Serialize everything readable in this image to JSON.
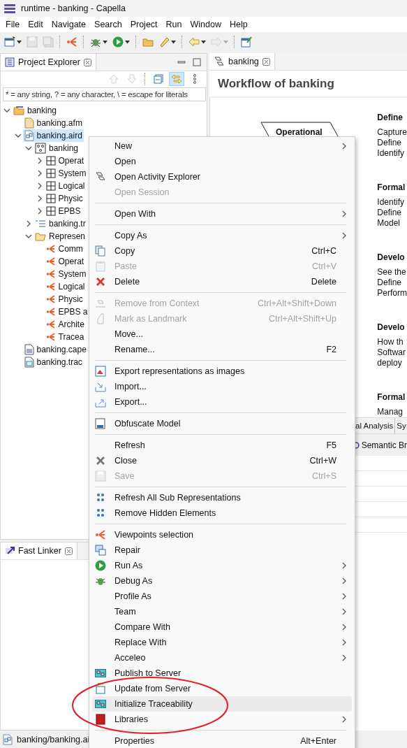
{
  "window": {
    "title": "runtime - banking - Capella"
  },
  "menu_bar": [
    "File",
    "Edit",
    "Navigate",
    "Search",
    "Project",
    "Run",
    "Window",
    "Help"
  ],
  "toolbar": [
    {
      "kind": "new",
      "disabled": false,
      "dropdown": true
    },
    {
      "kind": "save",
      "disabled": true,
      "dropdown": false
    },
    {
      "kind": "save-all",
      "disabled": true,
      "dropdown": false
    },
    {
      "kind": "separator"
    },
    {
      "kind": "capella",
      "disabled": false,
      "dropdown": false
    },
    {
      "kind": "separator"
    },
    {
      "kind": "debug",
      "disabled": false,
      "dropdown": true
    },
    {
      "kind": "run",
      "disabled": false,
      "dropdown": true
    },
    {
      "kind": "separator"
    },
    {
      "kind": "open",
      "disabled": false,
      "dropdown": false
    },
    {
      "kind": "pen",
      "disabled": false,
      "dropdown": true
    },
    {
      "kind": "separator"
    },
    {
      "kind": "back",
      "disabled": false,
      "dropdown": true
    },
    {
      "kind": "forward",
      "disabled": true,
      "dropdown": true
    },
    {
      "kind": "separator"
    },
    {
      "kind": "note",
      "disabled": false,
      "dropdown": false
    }
  ],
  "explorer": {
    "tab": {
      "label": "Project Explorer",
      "selected": true
    },
    "view_toolbar": [
      {
        "kind": "up",
        "disabled": true,
        "on": false
      },
      {
        "kind": "down",
        "disabled": true,
        "on": false
      },
      {
        "kind": "separator"
      },
      {
        "kind": "collapse",
        "disabled": false,
        "on": false
      },
      {
        "kind": "link",
        "disabled": false,
        "on": true
      },
      {
        "kind": "more",
        "disabled": false,
        "on": false
      }
    ],
    "filter": {
      "placeholder": "* = any string, ? = any character, \\ = escape for literals"
    },
    "tree": [
      {
        "label": "banking",
        "kind": "project",
        "expanded": true,
        "selected": false,
        "children": [
          {
            "label": "banking.afm",
            "kind": "afm",
            "selected": false
          },
          {
            "label": "banking.aird",
            "kind": "aird",
            "expanded": true,
            "selected": true,
            "children": [
              {
                "label": "banking",
                "kind": "model",
                "expanded": true,
                "selected": false,
                "children": [
                  {
                    "label": "Operat",
                    "kind": "layer",
                    "expanded": false,
                    "selected": false
                  },
                  {
                    "label": "System",
                    "kind": "layer",
                    "expanded": false,
                    "selected": false
                  },
                  {
                    "label": "Logical",
                    "kind": "layer",
                    "expanded": false,
                    "selected": false
                  },
                  {
                    "label": "Physic",
                    "kind": "layer",
                    "expanded": false,
                    "selected": false
                  },
                  {
                    "label": "EPBS",
                    "kind": "layer",
                    "expanded": false,
                    "selected": false
                  }
                ]
              },
              {
                "label": "banking.tr",
                "kind": "list",
                "expanded": false,
                "selected": false
              },
              {
                "label": "Represen",
                "kind": "folder",
                "expanded": true,
                "selected": false,
                "children": [
                  {
                    "label": "Comm",
                    "kind": "viewpoint",
                    "selected": false
                  },
                  {
                    "label": "Operat",
                    "kind": "viewpoint",
                    "selected": false
                  },
                  {
                    "label": "System",
                    "kind": "viewpoint",
                    "selected": false
                  },
                  {
                    "label": "Logical",
                    "kind": "viewpoint",
                    "selected": false
                  },
                  {
                    "label": "Physic",
                    "kind": "viewpoint",
                    "selected": false
                  },
                  {
                    "label": "EPBS a",
                    "kind": "viewpoint",
                    "selected": false
                  },
                  {
                    "label": "Archite",
                    "kind": "viewpoint",
                    "selected": false
                  },
                  {
                    "label": "Tracea",
                    "kind": "viewpoint",
                    "selected": false
                  }
                ]
              }
            ]
          },
          {
            "label": "banking.cape",
            "kind": "capella",
            "selected": false
          },
          {
            "label": "banking.trac",
            "kind": "trace",
            "selected": false
          }
        ]
      }
    ]
  },
  "fast_linker": {
    "tab": {
      "label": "Fast Linker",
      "selected": true
    }
  },
  "editor": {
    "tab": {
      "label": "banking",
      "selected": true
    },
    "heading": "Workflow of banking",
    "diagram_node": "Operational",
    "sections": [
      {
        "title": "Define",
        "lines": [
          "Capture",
          "Define",
          "Identify"
        ]
      },
      {
        "title": "Formal",
        "lines": [
          "Identify",
          "Define",
          "Model"
        ]
      },
      {
        "title": "Develo",
        "lines": [
          "See the",
          "Define",
          "Perform"
        ]
      },
      {
        "title": "Develo",
        "lines": [
          "How th",
          "Softwar",
          "deploy"
        ]
      },
      {
        "title": "Formal",
        "lines": [
          "Manag"
        ]
      }
    ]
  },
  "bottom_panel": {
    "tabs": [
      {
        "label": "al Analysis",
        "selected": false
      },
      {
        "label": "Sy",
        "selected": false
      }
    ],
    "view_tab": {
      "label": "Semantic Br"
    }
  },
  "status_bar": {
    "text": "banking/banking.ai"
  },
  "context_menu": [
    {
      "kind": "item",
      "label": "New",
      "submenu": true,
      "disabled": false,
      "selected": false
    },
    {
      "kind": "item",
      "label": "Open",
      "submenu": false,
      "disabled": false,
      "selected": false
    },
    {
      "kind": "item",
      "label": "Open Activity Explorer",
      "submenu": false,
      "disabled": false,
      "selected": false
    },
    {
      "kind": "item",
      "label": "Open Session",
      "submenu": false,
      "disabled": true,
      "selected": false
    },
    {
      "kind": "separator"
    },
    {
      "kind": "item",
      "label": "Open With",
      "submenu": true,
      "disabled": false,
      "selected": false
    },
    {
      "kind": "separator"
    },
    {
      "kind": "item",
      "label": "Copy As",
      "submenu": true,
      "disabled": false,
      "selected": false
    },
    {
      "kind": "item",
      "label": "Copy",
      "shortcut": "Ctrl+C",
      "submenu": false,
      "disabled": false,
      "selected": false
    },
    {
      "kind": "item",
      "label": "Paste",
      "shortcut": "Ctrl+V",
      "submenu": false,
      "disabled": true,
      "selected": false
    },
    {
      "kind": "item",
      "label": "Delete",
      "shortcut": "Delete",
      "submenu": false,
      "disabled": false,
      "selected": false
    },
    {
      "kind": "separator"
    },
    {
      "kind": "item",
      "label": "Remove from Context",
      "shortcut": "Ctrl+Alt+Shift+Down",
      "submenu": false,
      "disabled": true,
      "selected": false
    },
    {
      "kind": "item",
      "label": "Mark as Landmark",
      "shortcut": "Ctrl+Alt+Shift+Up",
      "submenu": false,
      "disabled": true,
      "selected": false
    },
    {
      "kind": "item",
      "label": "Move...",
      "submenu": false,
      "disabled": false,
      "selected": false
    },
    {
      "kind": "item",
      "label": "Rename...",
      "shortcut": "F2",
      "submenu": false,
      "disabled": false,
      "selected": false
    },
    {
      "kind": "separator"
    },
    {
      "kind": "item",
      "label": "Export representations as images",
      "submenu": false,
      "disabled": false,
      "selected": false
    },
    {
      "kind": "item",
      "label": "Import...",
      "submenu": false,
      "disabled": false,
      "selected": false
    },
    {
      "kind": "item",
      "label": "Export...",
      "submenu": false,
      "disabled": false,
      "selected": false
    },
    {
      "kind": "separator"
    },
    {
      "kind": "item",
      "label": "Obfuscate Model",
      "submenu": false,
      "disabled": false,
      "selected": false
    },
    {
      "kind": "separator"
    },
    {
      "kind": "item",
      "label": "Refresh",
      "shortcut": "F5",
      "submenu": false,
      "disabled": false,
      "selected": false
    },
    {
      "kind": "item",
      "label": "Close",
      "shortcut": "Ctrl+W",
      "submenu": false,
      "disabled": false,
      "selected": false
    },
    {
      "kind": "item",
      "label": "Save",
      "shortcut": "Ctrl+S",
      "submenu": false,
      "disabled": true,
      "selected": false
    },
    {
      "kind": "separator"
    },
    {
      "kind": "item",
      "label": "Refresh All Sub Representations",
      "submenu": false,
      "disabled": false,
      "selected": false
    },
    {
      "kind": "item",
      "label": "Remove Hidden Elements",
      "submenu": false,
      "disabled": false,
      "selected": false
    },
    {
      "kind": "separator"
    },
    {
      "kind": "item",
      "label": "Viewpoints selection",
      "submenu": false,
      "disabled": false,
      "selected": false
    },
    {
      "kind": "item",
      "label": "Repair",
      "submenu": false,
      "disabled": false,
      "selected": false
    },
    {
      "kind": "item",
      "label": "Run As",
      "submenu": true,
      "disabled": false,
      "selected": false
    },
    {
      "kind": "item",
      "label": "Debug As",
      "submenu": true,
      "disabled": false,
      "selected": false
    },
    {
      "kind": "item",
      "label": "Profile As",
      "submenu": true,
      "disabled": false,
      "selected": false
    },
    {
      "kind": "item",
      "label": "Team",
      "submenu": true,
      "disabled": false,
      "selected": false
    },
    {
      "kind": "item",
      "label": "Compare With",
      "submenu": true,
      "disabled": false,
      "selected": false
    },
    {
      "kind": "item",
      "label": "Replace With",
      "submenu": true,
      "disabled": false,
      "selected": false
    },
    {
      "kind": "item",
      "label": "Acceleo",
      "submenu": true,
      "disabled": false,
      "selected": false
    },
    {
      "kind": "item",
      "label": "Publish to Server",
      "submenu": false,
      "disabled": false,
      "selected": false
    },
    {
      "kind": "item",
      "label": "Update from Server",
      "submenu": false,
      "disabled": false,
      "selected": false
    },
    {
      "kind": "item",
      "label": "Initialize Traceability",
      "submenu": false,
      "disabled": false,
      "selected": true
    },
    {
      "kind": "item",
      "label": "Libraries",
      "submenu": true,
      "disabled": false,
      "selected": false
    },
    {
      "kind": "separator"
    },
    {
      "kind": "item",
      "label": "Properties",
      "shortcut": "Alt+Enter",
      "submenu": false,
      "disabled": false,
      "selected": false
    }
  ]
}
